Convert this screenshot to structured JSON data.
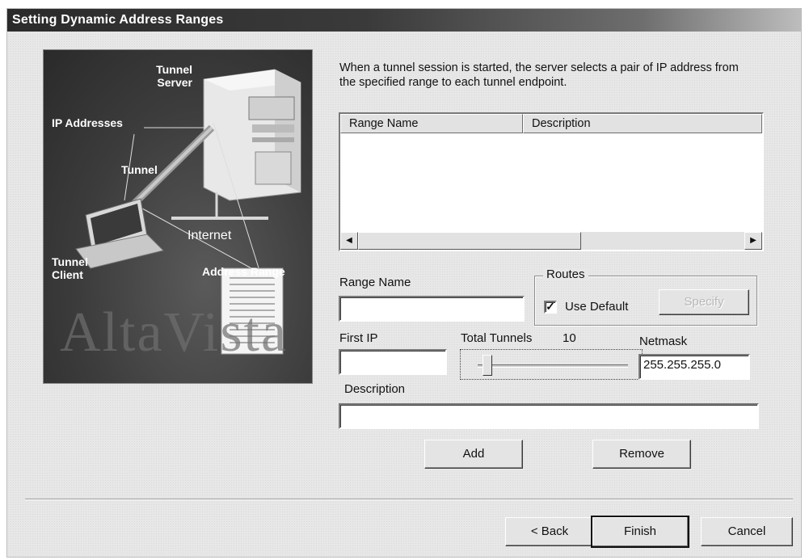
{
  "window": {
    "title": "Setting Dynamic Address Ranges"
  },
  "illustration": {
    "labels": {
      "tunnel_server": "Tunnel Server",
      "ip_addresses": "IP Addresses",
      "tunnel": "Tunnel",
      "internet": "Internet",
      "tunnel_client": "Tunnel Client",
      "address_range": "Address Range"
    },
    "watermark": "AltaVista"
  },
  "intro_text": "When a tunnel session is started, the server selects a pair of IP address from the specified range to each tunnel endpoint.",
  "range_list": {
    "columns": [
      "Range Name",
      "Description"
    ],
    "rows": []
  },
  "form": {
    "range_name_label": "Range Name",
    "range_name_value": "",
    "routes_label": "Routes",
    "use_default_label": "Use Default",
    "use_default_checked": true,
    "specify_label": "Specify",
    "first_ip_label": "First IP",
    "first_ip_value": "",
    "total_tunnels_label": "Total Tunnels",
    "total_tunnels_value": "10",
    "netmask_label": "Netmask",
    "netmask_value": "255.255.255.0",
    "description_label": "Description",
    "description_value": ""
  },
  "actions": {
    "add_label": "Add",
    "remove_label": "Remove"
  },
  "wizard": {
    "back_label": "< Back",
    "finish_label": "Finish",
    "cancel_label": "Cancel"
  }
}
